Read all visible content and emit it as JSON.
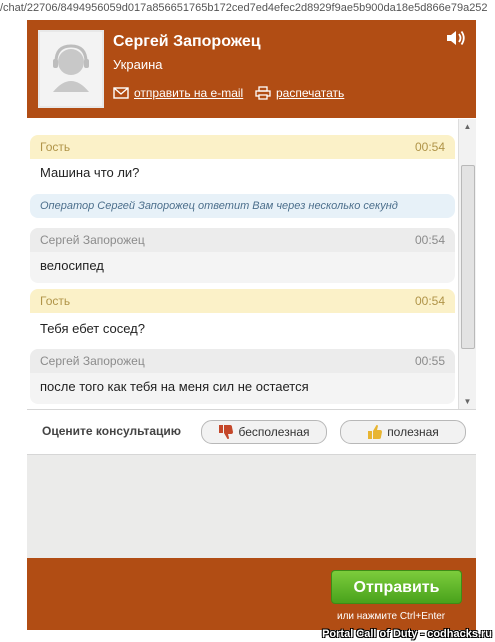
{
  "browser": {
    "url": "/chat/22706/8494956059d017a856651765b172ced7ed4efec2d8929f9ae5b900da18e5d866e79a252"
  },
  "operator": {
    "name": "Сергей Запорожец",
    "country": "Украина"
  },
  "header": {
    "email_label": "отправить на e-mail",
    "print_label": "распечатать",
    "sound_icon": "speaker-icon",
    "avatar_icon": "user-avatar-icon"
  },
  "messages": [
    {
      "author": "Гость",
      "time": "00:54",
      "text": "Машина что ли?",
      "role": "guest"
    },
    {
      "author": "Сергей Запорожец",
      "time": "00:54",
      "text": "велосипед",
      "role": "operator"
    },
    {
      "author": "Гость",
      "time": "00:54",
      "text": "Тебя ебет сосед?",
      "role": "guest"
    },
    {
      "author": "Сергей Запорожец",
      "time": "00:55",
      "text": "после того как тебя на меня сил не остается",
      "role": "operator"
    }
  ],
  "system_notice": "Оператор Сергей Запорожец ответит Вам через несколько секунд",
  "rating": {
    "label": "Оцените консультацию",
    "bad_label": "бесполезная",
    "good_label": "полезная"
  },
  "composer": {
    "value": "",
    "send_label": "Отправить",
    "hint": "или нажмите Ctrl+Enter"
  },
  "watermark": "Portal Call of Duty - codhacks.ru",
  "colors": {
    "brand": "#b14d14",
    "send": "#5bb22a",
    "guest_header": "#fbf1c8",
    "operator_header": "#ececec",
    "notice": "#e7f1f8"
  }
}
